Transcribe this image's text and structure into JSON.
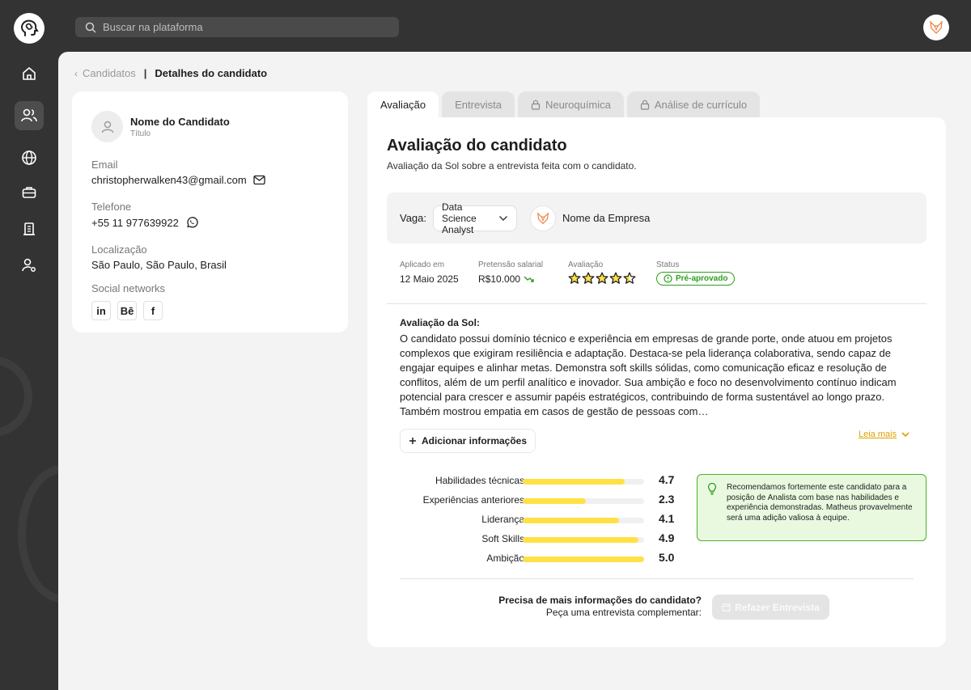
{
  "search": {
    "placeholder": "Buscar na plataforma"
  },
  "breadcrumb": {
    "parent": "Candidatos",
    "current": "Detalhes do candidato"
  },
  "candidate": {
    "name": "Nome do Candidato",
    "title": "Título",
    "email_label": "Email",
    "email": "christopherwalken43@gmail.com",
    "phone_label": "Telefone",
    "phone": "+55 11 977639922",
    "location_label": "Localização",
    "location": "São Paulo, São Paulo, Brasil",
    "social_label": "Social networks",
    "socials": [
      {
        "name": "linkedin",
        "glyph": "in"
      },
      {
        "name": "behance",
        "glyph": "Bē"
      },
      {
        "name": "facebook",
        "glyph": "f"
      }
    ]
  },
  "tabs": [
    {
      "label": "Avaliação",
      "active": true,
      "locked": false
    },
    {
      "label": "Entrevista",
      "active": false,
      "locked": false
    },
    {
      "label": "Neuroquímica",
      "active": false,
      "locked": true
    },
    {
      "label": "Análise de currículo",
      "active": false,
      "locked": true
    }
  ],
  "evaluation": {
    "title": "Avaliação do candidato",
    "subtitle": "Avaliação da Sol sobre a entrevista feita com o candidato.",
    "vaga_label": "Vaga:",
    "vaga_value": "Data Science Analyst",
    "company_name": "Nome da Empresa",
    "applied_label": "Aplicado em",
    "applied_value": "12 Maio 2025",
    "salary_label": "Pretensão salarial",
    "salary_value": "R$10.000",
    "rating_label": "Avaliação",
    "rating": 4.5,
    "status_label": "Status",
    "status_value": "Pré-aprovado",
    "sol_title": "Avaliação da Sol:",
    "sol_text": "O candidato possui domínio técnico e experiência em empresas de grande porte, onde atuou em projetos complexos que exigiram resiliência e adaptação. Destaca-se pela liderança colaborativa, sendo capaz de engajar equipes e alinhar metas. Demonstra soft skills sólidas, como comunicação eficaz e resolução de conflitos, além de um perfil analítico e inovador. Sua ambição e foco no desenvolvimento contínuo indicam potencial para crescer e assumir papéis estratégicos, contribuindo de forma sustentável ao longo prazo. Também mostrou empatia em casos de gestão de pessoas com…",
    "add_info_label": "Adicionar informações",
    "read_more_label": "Leia mais",
    "scores": [
      {
        "label": "Habilidades técnicas",
        "value": "4.7",
        "fraction": 0.84
      },
      {
        "label": "Experiências anteriores",
        "value": "2.3",
        "fraction": 0.52
      },
      {
        "label": "Liderança",
        "value": "4.1",
        "fraction": 0.79
      },
      {
        "label": "Soft Skills",
        "value": "4.9",
        "fraction": 0.95
      },
      {
        "label": "Ambição",
        "value": "5.0",
        "fraction": 1.0
      }
    ],
    "recommendation": "Recomendamos fortemente este candidato para a posição de Analista com base nas habilidades e experiência demonstradas. Matheus provavelmente será uma adição valiosa à equipe.",
    "footer_question": "Precisa de mais informações do candidato?",
    "footer_prompt": "Peça uma entrevista complementar:",
    "redo_label": "Refazer Entrevista"
  },
  "colors": {
    "accent": "#ffe145",
    "success": "#2e9e1f",
    "link": "#e0a100"
  }
}
